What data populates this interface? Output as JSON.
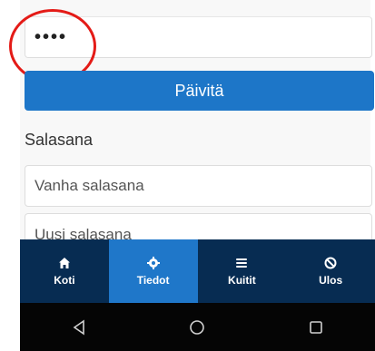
{
  "pin_field": {
    "value": "••••"
  },
  "update_button": {
    "label": "Päivitä"
  },
  "password_section": {
    "title": "Salasana",
    "old_placeholder": "Vanha salasana",
    "new_placeholder": "Uusi salasana"
  },
  "tabbar": {
    "tabs": [
      {
        "label": "Koti",
        "icon": "home-icon"
      },
      {
        "label": "Tiedot",
        "icon": "gear-icon",
        "active": true
      },
      {
        "label": "Kuitit",
        "icon": "menu-icon"
      },
      {
        "label": "Ulos",
        "icon": "block-icon"
      }
    ]
  },
  "colors": {
    "primary": "#1d76c8",
    "tabbar_bg": "#072c52",
    "annotation_circle": "#e41b17"
  }
}
